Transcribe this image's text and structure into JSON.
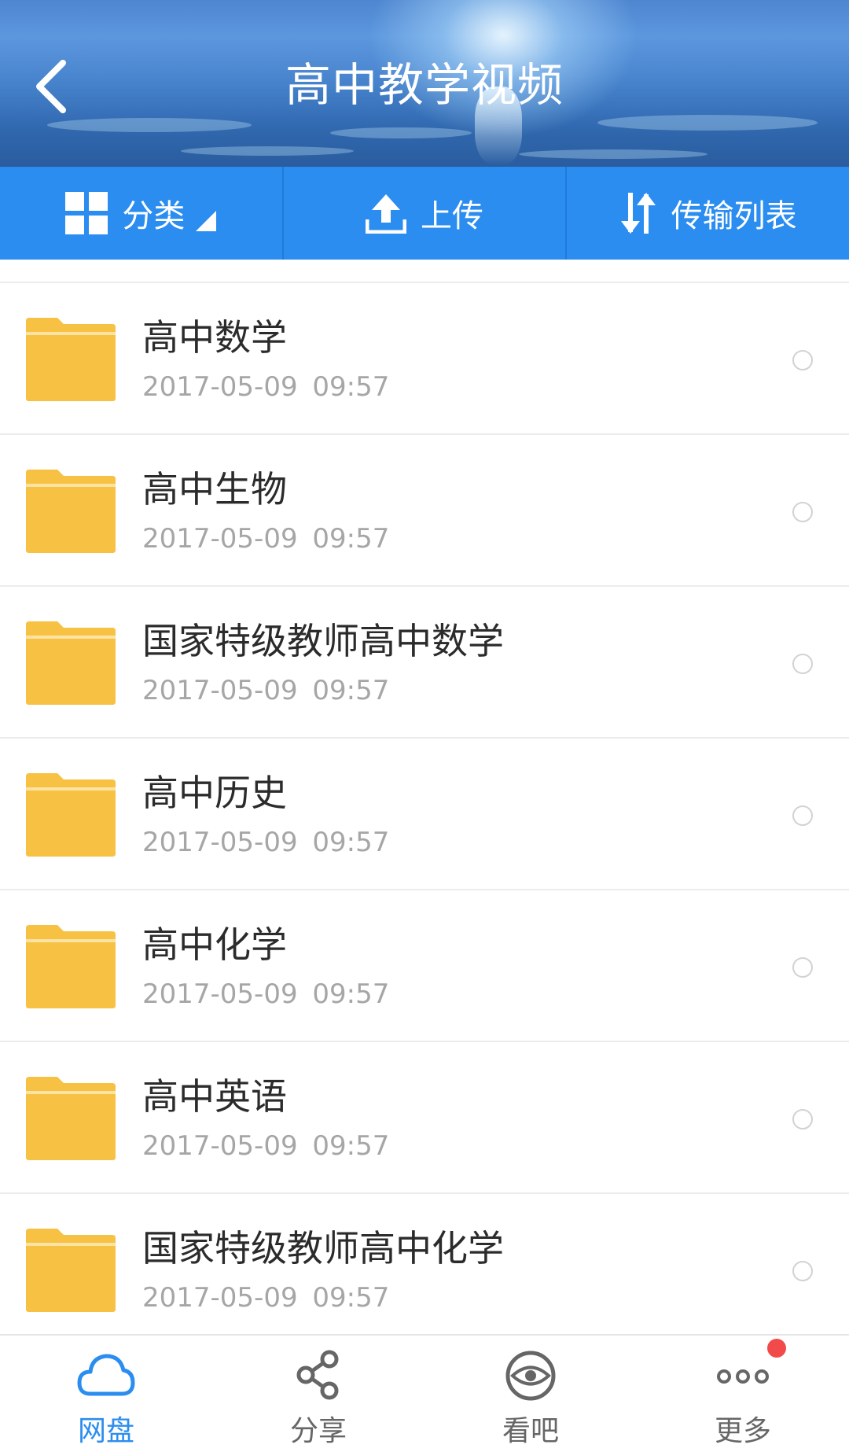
{
  "header": {
    "title": "高中教学视频",
    "back_icon": "chevron-left-icon"
  },
  "toolbar": {
    "category_label": "分类",
    "upload_label": "上传",
    "transfer_label": "传输列表"
  },
  "files": [
    {
      "name": "高中数学",
      "date": "2017-05-09  09:57"
    },
    {
      "name": "高中生物",
      "date": "2017-05-09  09:57"
    },
    {
      "name": "国家特级教师高中数学",
      "date": "2017-05-09  09:57"
    },
    {
      "name": "高中历史",
      "date": "2017-05-09  09:57"
    },
    {
      "name": "高中化学",
      "date": "2017-05-09  09:57"
    },
    {
      "name": "高中英语",
      "date": "2017-05-09  09:57"
    },
    {
      "name": "国家特级教师高中化学",
      "date": "2017-05-09  09:57"
    }
  ],
  "nav": [
    {
      "label": "网盘",
      "icon": "cloud-icon",
      "active": true
    },
    {
      "label": "分享",
      "icon": "share-icon",
      "active": false
    },
    {
      "label": "看吧",
      "icon": "eye-icon",
      "active": false
    },
    {
      "label": "更多",
      "icon": "more-icon",
      "active": false
    }
  ],
  "colors": {
    "accent": "#2b8df0",
    "folder": "#f7c244",
    "badge": "#f24a4a"
  }
}
